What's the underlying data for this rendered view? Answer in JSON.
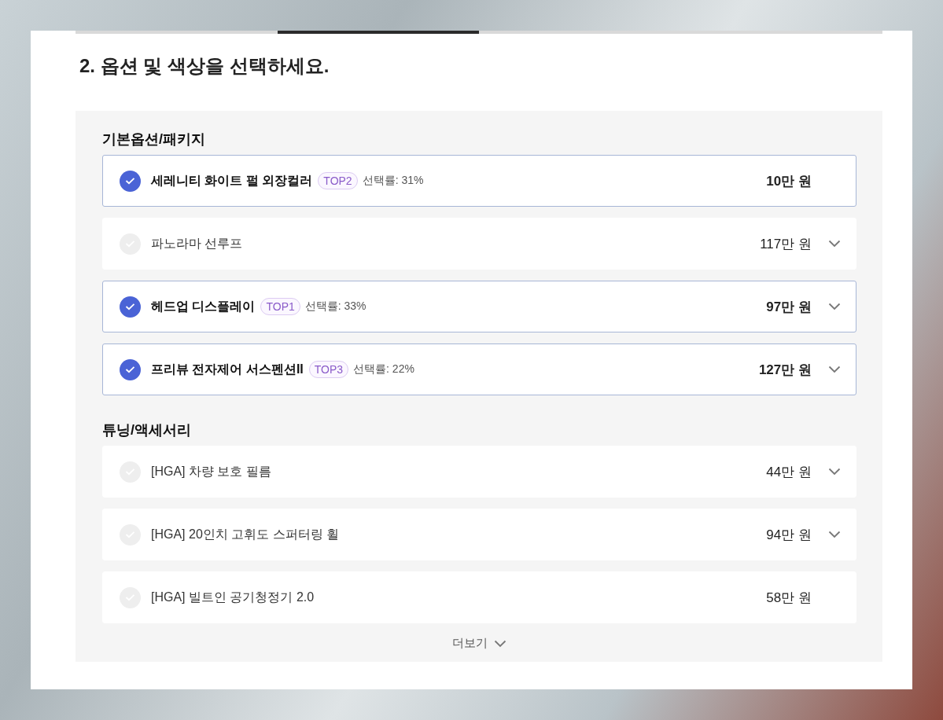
{
  "progress": [
    {
      "selected": false
    },
    {
      "selected": true
    },
    {
      "selected": false
    },
    {
      "selected": false
    }
  ],
  "title": "2. 옵션 및 색상을 선택하세요.",
  "sections": [
    {
      "heading": "기본옵션/패키지",
      "options": [
        {
          "name": "세레니티 화이트 펄 외장컬러",
          "checked": true,
          "badge": "TOP2",
          "rate": "선택률: 31%",
          "price": "10만 원",
          "expandable": false
        },
        {
          "name": "파노라마 선루프",
          "checked": false,
          "price": "117만 원",
          "expandable": true
        },
        {
          "name": "헤드업 디스플레이",
          "checked": true,
          "badge": "TOP1",
          "rate": "선택률: 33%",
          "price": "97만 원",
          "expandable": true
        },
        {
          "name": "프리뷰 전자제어 서스펜션II",
          "checked": true,
          "badge": "TOP3",
          "rate": "선택률: 22%",
          "price": "127만 원",
          "expandable": true
        }
      ]
    },
    {
      "heading": "튜닝/액세서리",
      "options": [
        {
          "name": "[HGA] 차량 보호 필름",
          "checked": false,
          "price": "44만 원",
          "expandable": true
        },
        {
          "name": "[HGA] 20인치 고휘도 스퍼터링 휠",
          "checked": false,
          "price": "94만 원",
          "expandable": true
        },
        {
          "name": "[HGA] 빌트인 공기청정기 2.0",
          "checked": false,
          "price": "58만 원",
          "expandable": false
        }
      ]
    }
  ],
  "more": "더보기"
}
